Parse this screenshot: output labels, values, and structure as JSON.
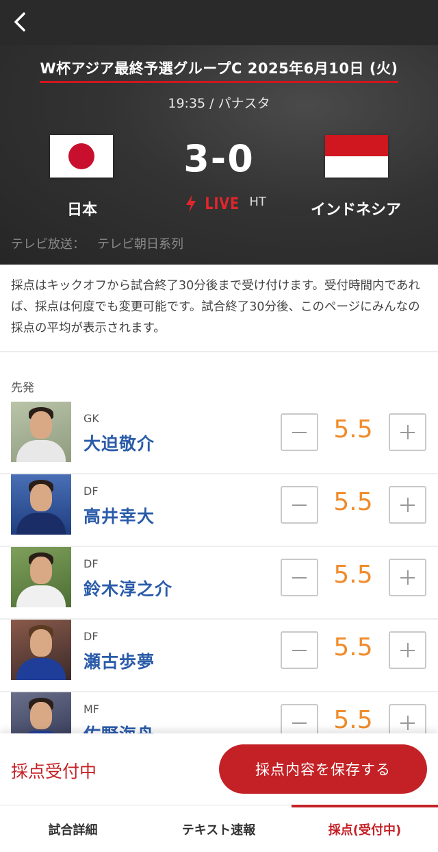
{
  "header": {
    "match_title": "W杯アジア最終予選グループC 2025年6月10日 (火)",
    "match_info": "19:35 / パナスタ",
    "home_team": "日本",
    "away_team": "インドネシア",
    "score": "3-0",
    "live_label": "LIVE",
    "period": "HT",
    "tv_label": "テレビ放送：",
    "tv_channel": "テレビ朝日系列"
  },
  "notice": "採点はキックオフから試合終了30分後まで受け付けます。受付時間内であれば、採点は何度でも変更可能です。試合終了30分後、このページにみんなの採点の平均が表示されます。",
  "section_label": "先発",
  "players": [
    {
      "position": "GK",
      "name": "大迫敬介",
      "score": "5.5"
    },
    {
      "position": "DF",
      "name": "高井幸大",
      "score": "5.5"
    },
    {
      "position": "DF",
      "name": "鈴木淳之介",
      "score": "5.5"
    },
    {
      "position": "DF",
      "name": "瀬古歩夢",
      "score": "5.5"
    },
    {
      "position": "MF",
      "name": "佐野海舟",
      "score": "5.5"
    }
  ],
  "save_bar": {
    "status": "採点受付中",
    "save_button": "採点内容を保存する"
  },
  "tabs": [
    {
      "label": "試合詳細"
    },
    {
      "label": "テキスト速報"
    },
    {
      "label": "採点(受付中)"
    }
  ],
  "colors": {
    "accent": "#c42126",
    "score": "#ef8c2c",
    "player_name": "#2b5caa"
  }
}
